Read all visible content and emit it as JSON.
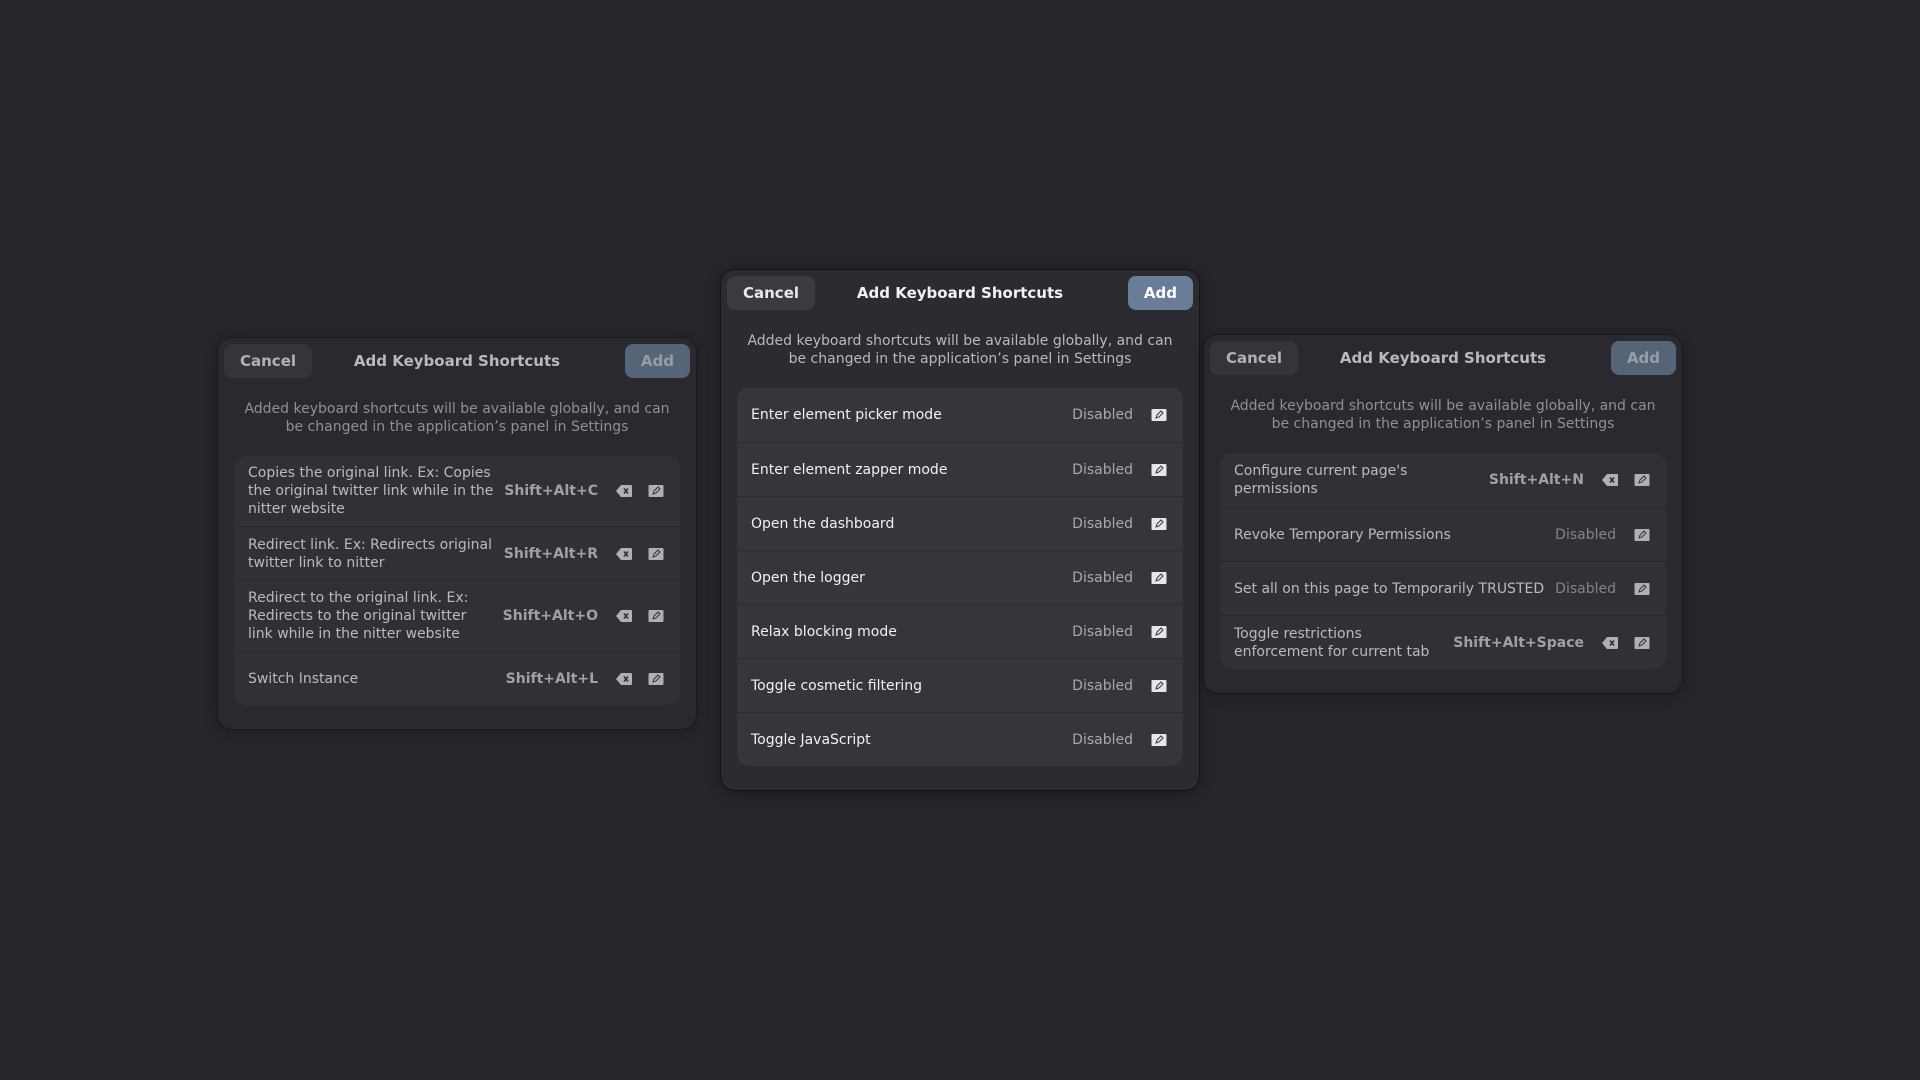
{
  "dialogs": [
    {
      "cancel_label": "Cancel",
      "title": "Add Keyboard Shortcuts",
      "add_label": "Add",
      "description": "Added keyboard shortcuts will be available globally, and can be changed in the application’s panel in Settings",
      "rows": [
        {
          "label": "Copies the original link. Ex: Copies the original twitter link while in the nitter website",
          "accel": "Shift+Alt+C"
        },
        {
          "label": "Redirect link. Ex: Redirects original twitter link to nitter",
          "accel": "Shift+Alt+R"
        },
        {
          "label": "Redirect to the original link. Ex: Redirects to the original twitter link while in the nitter website",
          "accel": "Shift+Alt+O"
        },
        {
          "label": "Switch Instance",
          "accel": "Shift+Alt+L"
        }
      ]
    },
    {
      "cancel_label": "Cancel",
      "title": "Add Keyboard Shortcuts",
      "add_label": "Add",
      "description": "Added keyboard shortcuts will be available globally, and can be changed in the application’s panel in Settings",
      "rows": [
        {
          "label": "Enter element picker mode",
          "accel": "Disabled"
        },
        {
          "label": "Enter element zapper mode",
          "accel": "Disabled"
        },
        {
          "label": "Open the dashboard",
          "accel": "Disabled"
        },
        {
          "label": "Open the logger",
          "accel": "Disabled"
        },
        {
          "label": "Relax blocking mode",
          "accel": "Disabled"
        },
        {
          "label": "Toggle cosmetic filtering",
          "accel": "Disabled"
        },
        {
          "label": "Toggle JavaScript",
          "accel": "Disabled"
        }
      ]
    },
    {
      "cancel_label": "Cancel",
      "title": "Add Keyboard Shortcuts",
      "add_label": "Add",
      "description": "Added keyboard shortcuts will be available globally, and can be changed in the application’s panel in Settings",
      "rows": [
        {
          "label": "Configure current page's permissions",
          "accel": "Shift+Alt+N"
        },
        {
          "label": "Revoke Temporary Permissions",
          "accel": "Disabled"
        },
        {
          "label": "Set all on this page to Temporarily TRUSTED",
          "accel": "Disabled"
        },
        {
          "label": "Toggle restrictions enforcement for current tab",
          "accel": "Shift+Alt+Space"
        }
      ]
    }
  ],
  "icons": {
    "clear": "backspace-clear-icon",
    "edit": "edit-shortcut-icon"
  },
  "colors": {
    "background": "#25252c",
    "dialog": "#2b2b31",
    "list": "#35353b",
    "add_button": "#6a7d96"
  }
}
